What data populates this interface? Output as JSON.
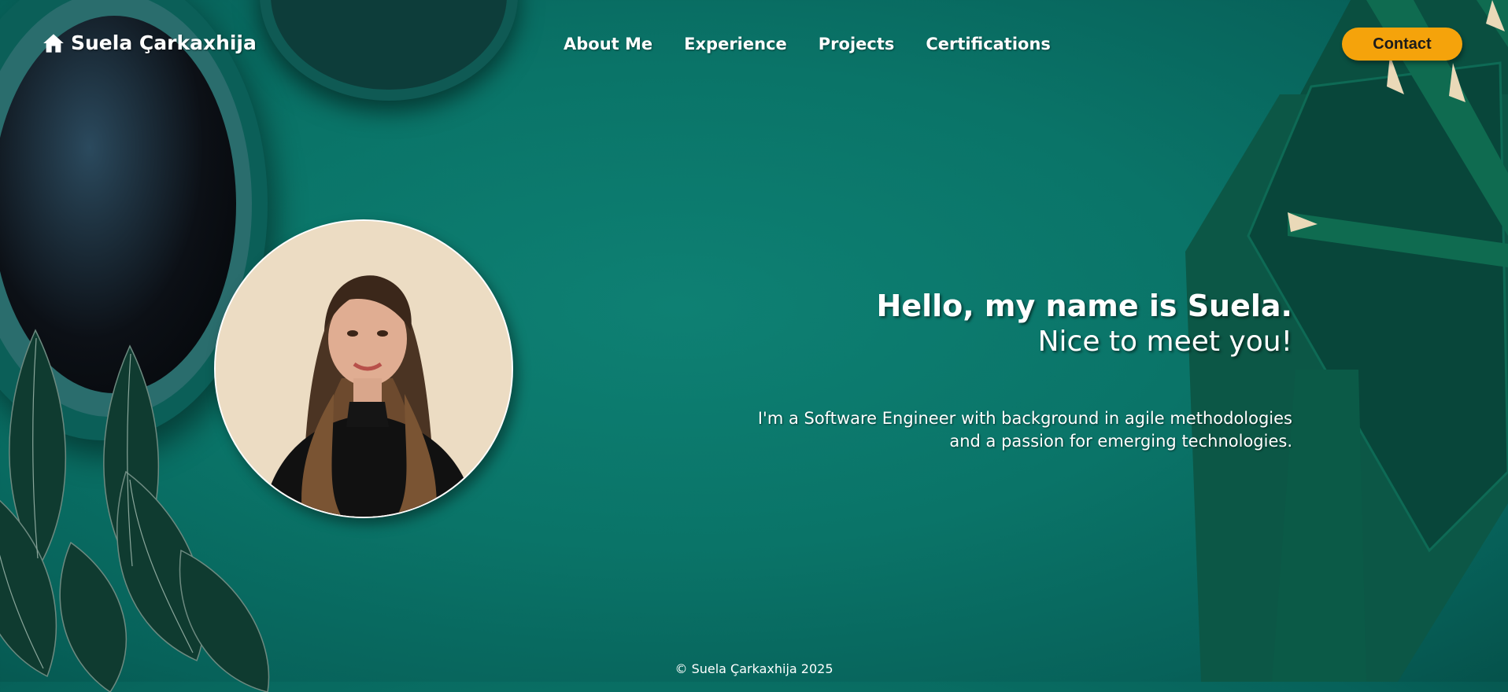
{
  "header": {
    "brand": "Suela Çarkaxhija",
    "brand_icon": "home-icon",
    "nav": [
      "About Me",
      "Experience",
      "Projects",
      "Certifications"
    ],
    "contact_label": "Contact"
  },
  "hero": {
    "title": "Hello, my name is Suela.",
    "subtitle": "Nice to meet you!",
    "description_line1": "I'm a Software Engineer with background in agile methodologies",
    "description_line2": "and a passion for emerging technologies."
  },
  "footer": {
    "copyright": "© Suela Çarkaxhija 2025"
  },
  "colors": {
    "background": "#0a7468",
    "accent": "#f5a30b",
    "text": "#ffffff"
  }
}
